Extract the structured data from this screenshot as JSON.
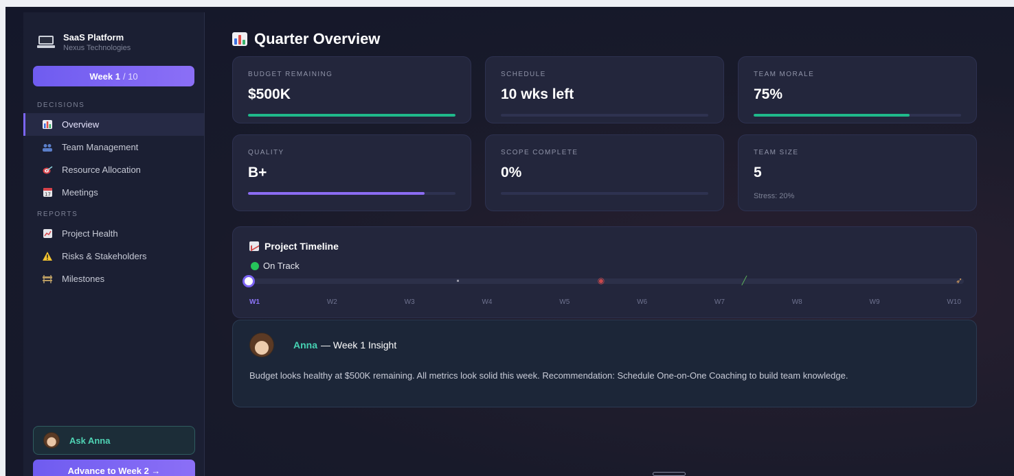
{
  "brand": {
    "title": "SaaS Platform",
    "subtitle": "Nexus Technologies",
    "icon": "laptop-icon"
  },
  "week": {
    "current": "Week 1",
    "total": "/ 10"
  },
  "sidebar": {
    "decisions_label": "DECISIONS",
    "reports_label": "REPORTS",
    "decisions": [
      {
        "label": "Overview",
        "icon": "bar-chart-icon",
        "active": true
      },
      {
        "label": "Team Management",
        "icon": "people-icon"
      },
      {
        "label": "Resource Allocation",
        "icon": "target-icon"
      },
      {
        "label": "Meetings",
        "icon": "calendar-icon"
      }
    ],
    "reports": [
      {
        "label": "Project Health",
        "icon": "trend-chart-icon"
      },
      {
        "label": "Risks & Stakeholders",
        "icon": "warning-icon"
      },
      {
        "label": "Milestones",
        "icon": "construction-icon"
      }
    ],
    "ask_label": "Ask Anna",
    "advance_label": "Advance to Week 2 →"
  },
  "main": {
    "title": "Quarter Overview",
    "metrics": [
      {
        "label": "BUDGET REMAINING",
        "value": "$500K",
        "fill": 1.0,
        "color": "#1fb98a"
      },
      {
        "label": "SCHEDULE",
        "value": "10 wks left",
        "fill": 0.0,
        "color": "#1fb98a"
      },
      {
        "label": "TEAM MORALE",
        "value": "75%",
        "fill": 0.75,
        "color": "#1fb98a"
      },
      {
        "label": "QUALITY",
        "value": "B+",
        "fill": 0.85,
        "color": "#8b6cf3"
      },
      {
        "label": "SCOPE COMPLETE",
        "value": "0%",
        "fill": 0.0,
        "color": "#8b6cf3"
      },
      {
        "label": "TEAM SIZE",
        "value": "5",
        "sub": "Stress: 20%"
      }
    ],
    "timeline": {
      "title": "Project Timeline",
      "status": "On Track",
      "weeks": [
        "W1",
        "W2",
        "W3",
        "W4",
        "W5",
        "W6",
        "W7",
        "W8",
        "W9",
        "W10"
      ],
      "current_week": 1,
      "milestones": [
        {
          "icon": "clipboard-icon",
          "glyph": "▪",
          "position": 0.3,
          "color": "#9a9aa8"
        },
        {
          "icon": "target-icon",
          "glyph": "◉",
          "position": 0.5,
          "color": "#c9484c"
        },
        {
          "icon": "pencil-icon",
          "glyph": "╱",
          "position": 0.7,
          "color": "#5fb85a"
        },
        {
          "icon": "rocket-icon",
          "glyph": "➶",
          "position": 1.0,
          "color": "#d9a060"
        }
      ]
    },
    "insight": {
      "name": "Anna",
      "heading": "— Week 1 Insight",
      "text": "Budget looks healthy at $500K remaining. All metrics look solid this week. Recommendation: Schedule One-on-One Coaching to build team knowledge."
    }
  }
}
